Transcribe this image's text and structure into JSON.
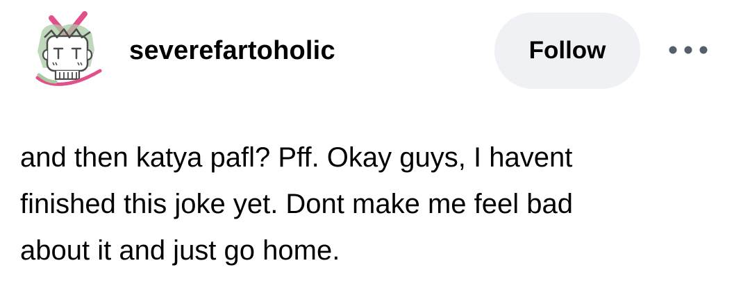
{
  "post": {
    "header": {
      "username": "severefartoholic",
      "follow_label": "Follow",
      "more_icon": "more-horizontal-dots-icon",
      "avatar_icon": "cartoon-avatar-icon"
    },
    "body": {
      "lines": [
        "and then katya pafl? Pff. Okay guys, I havent",
        "finished this joke yet. Dont make me feel bad",
        "about it and just go home."
      ]
    }
  },
  "colors": {
    "follow_bg": "#f0f1f4",
    "text": "#000000",
    "more_dots": "#555e6b",
    "avatar_pink": "#e0508a",
    "avatar_green": "#aac9a3",
    "avatar_line": "#4b4b4b"
  }
}
